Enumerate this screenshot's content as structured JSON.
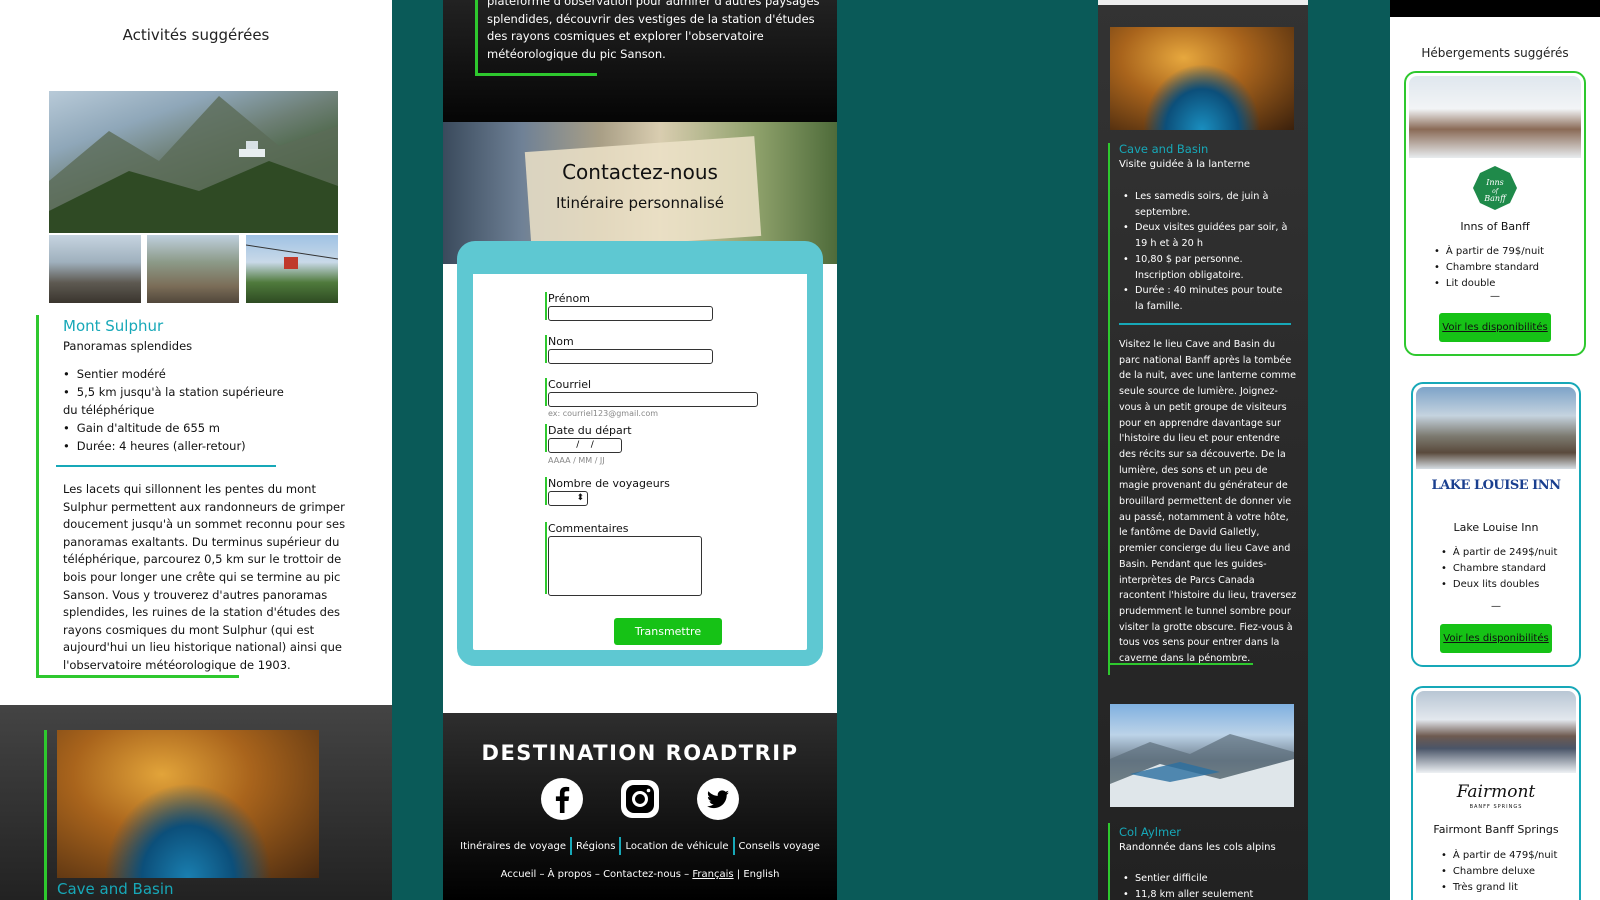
{
  "panel1": {
    "heading": "Activités suggérées",
    "activity": {
      "title": "Mont Sulphur",
      "subtitle": "Panoramas splendides",
      "bullets": [
        "Sentier modéré",
        "5,5 km jusqu'à la station supérieure du téléphérique",
        "Gain d'altitude de 655 m",
        "Durée: 4 heures (aller-retour)"
      ],
      "description": "Les lacets qui sillonnent les pentes du mont Sulphur permettent aux randonneurs de grimper doucement jusqu'à un sommet reconnu pour ses panoramas exaltants. Du terminus supérieur du téléphérique, parcourez 0,5 km sur le trottoir de bois pour longer une crête qui se termine au pic Sanson. Vous y trouverez d'autres panoramas splendides, les ruines de la station d'études des rayons cosmiques du mont Sulphur (qui est aujourd'hui un lieu historique national) ainsi que l'observatoire météorologique de 1903."
    },
    "next_title": "Cave and Basin"
  },
  "panel2": {
    "top_text": "plateforme d'observation pour admirer d'autres paysages splendides, découvrir des vestiges de la station d'études des rayons cosmiques et explorer l'observatoire météorologique du pic Sanson.",
    "hero_title": "Contactez-nous",
    "hero_subtitle": "Itinéraire personnalisé",
    "form": {
      "prenom_label": "Prénom",
      "nom_label": "Nom",
      "courriel_label": "Courriel",
      "courriel_placeholder": "ex: courriel123@gmail.com",
      "date_label": "Date du départ",
      "date_value": "/    /",
      "date_hint": "AAAA / MM / JJ",
      "voyageurs_label": "Nombre de voyageurs",
      "stepper_glyph": "⬍",
      "commentaires_label": "Commentaires",
      "submit_label": "Transmettre"
    },
    "footer": {
      "brand": "DESTINATION ROADTRIP",
      "nav1": [
        "Itinéraires de voyage",
        "Régions",
        "Location de véhicule",
        "Conseils voyage"
      ],
      "nav2": {
        "accueil": "Accueil",
        "apropos": "– À propos",
        "contact": "– Contactez-nous –",
        "francais": "Français",
        "pipe": "|",
        "english": "English"
      }
    }
  },
  "panel3": {
    "item1": {
      "title": "Cave and Basin",
      "subtitle": "Visite guidée à la lanterne",
      "bullets": [
        "Les samedis soirs, de juin à septembre.",
        "Deux visites guidées par soir, à 19 h et à 20 h",
        "10,80 $ par personne. Inscription obligatoire.",
        "Durée : 40 minutes pour toute la famille."
      ],
      "description": "Visitez le lieu Cave and Basin du parc national Banff après la tombée de la nuit, avec une lanterne comme seule source de lumière. Joignez-vous à un petit groupe de visiteurs pour en apprendre davantage sur l'histoire du lieu et pour entendre des récits sur sa découverte. De la lumière, des sons et un peu de magie provenant du générateur de brouillard permettent de donner vie au passé, notamment à votre hôte, le fantôme de David Galletly, premier concierge du lieu Cave and Basin. Pendant que les guides-interprètes de Parcs Canada racontent l'histoire du lieu, traversez prudemment le tunnel sombre pour visiter la grotte obscure. Fiez-vous à tous vos sens pour entrer dans la caverne dans la pénombre."
    },
    "item2": {
      "title": "Col Aylmer",
      "subtitle": "Randonnée dans les cols alpins",
      "bullets": [
        "Sentier difficile",
        "11,8 km aller seulement"
      ]
    }
  },
  "panel4": {
    "heading": "Hébergements suggérés",
    "hotels": [
      {
        "logo": "Inns of Banff",
        "name": "Inns of Banff",
        "bullets": [
          "À partir de 79$/nuit",
          "Chambre standard",
          "Lit double"
        ],
        "dash": "—",
        "button": "Voir les disponibilités"
      },
      {
        "logo": "LAKE LOUISE INN",
        "name": "Lake Louise Inn",
        "bullets": [
          "À partir de 249$/nuit",
          "Chambre standard",
          "Deux lits doubles"
        ],
        "dash": "—",
        "button": "Voir les disponibilités"
      },
      {
        "logo": "Fairmont",
        "logo_sub": "BANFF SPRINGS",
        "name": "Fairmont Banff Springs",
        "bullets": [
          "À partir de 479$/nuit",
          "Chambre deluxe",
          "Très grand lit"
        ]
      }
    ]
  },
  "colors": {
    "accent_green": "#2ec82e",
    "accent_teal": "#17a8b8",
    "button_green": "#16c216",
    "background": "#0a5a58"
  },
  "icons": [
    "facebook-icon",
    "instagram-icon",
    "twitter-icon",
    "stepper-icon"
  ]
}
